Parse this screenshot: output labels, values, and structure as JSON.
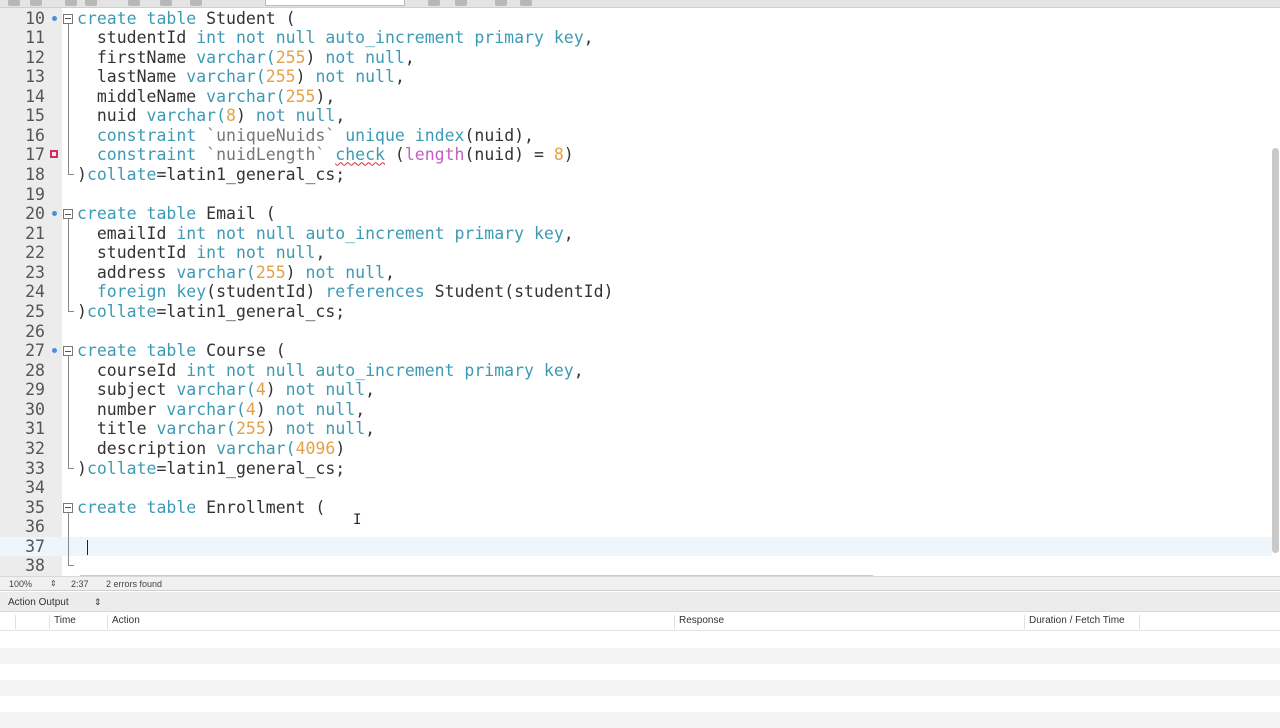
{
  "editor": {
    "first_line": 10,
    "current_line": 37,
    "lines": [
      {
        "n": "10",
        "marker": "dot",
        "fold": "start",
        "segs": [
          [
            "create table",
            "kw"
          ],
          [
            " Student (",
            ""
          ]
        ]
      },
      {
        "n": "11",
        "segs": [
          [
            "  studentId ",
            ""
          ],
          [
            "int not null auto_increment primary key",
            "kw"
          ],
          [
            ",",
            ""
          ]
        ]
      },
      {
        "n": "12",
        "segs": [
          [
            "  firstName ",
            ""
          ],
          [
            "varchar(",
            "kw"
          ],
          [
            "255",
            "num"
          ],
          [
            ") ",
            ""
          ],
          [
            "not null",
            "kw"
          ],
          [
            ",",
            ""
          ]
        ]
      },
      {
        "n": "13",
        "segs": [
          [
            "  lastName ",
            ""
          ],
          [
            "varchar(",
            "kw"
          ],
          [
            "255",
            "num"
          ],
          [
            ") ",
            ""
          ],
          [
            "not null",
            "kw"
          ],
          [
            ",",
            ""
          ]
        ]
      },
      {
        "n": "14",
        "segs": [
          [
            "  middleName ",
            ""
          ],
          [
            "varchar(",
            "kw"
          ],
          [
            "255",
            "num"
          ],
          [
            "),",
            ""
          ]
        ]
      },
      {
        "n": "15",
        "segs": [
          [
            "  nuid ",
            ""
          ],
          [
            "varchar(",
            "kw"
          ],
          [
            "8",
            "num"
          ],
          [
            ") ",
            ""
          ],
          [
            "not null",
            "kw"
          ],
          [
            ",",
            ""
          ]
        ]
      },
      {
        "n": "16",
        "segs": [
          [
            "  ",
            ""
          ],
          [
            "constraint",
            "kw"
          ],
          [
            " `uniqueNuids` ",
            "str"
          ],
          [
            "unique index",
            "kw"
          ],
          [
            "(nuid),",
            ""
          ]
        ]
      },
      {
        "n": "17",
        "marker": "err",
        "segs": [
          [
            "  ",
            ""
          ],
          [
            "constraint",
            "kw"
          ],
          [
            " `nuidLength` ",
            "str"
          ],
          [
            "check",
            "kw squig"
          ],
          [
            " (",
            ""
          ],
          [
            "length",
            "fn"
          ],
          [
            "(nuid) = ",
            ""
          ],
          [
            "8",
            "num"
          ],
          [
            ")",
            ""
          ]
        ]
      },
      {
        "n": "18",
        "fold": "end",
        "segs": [
          [
            ")",
            ""
          ],
          [
            "collate",
            "kw"
          ],
          [
            "=latin1_general_cs;",
            ""
          ]
        ]
      },
      {
        "n": "19",
        "segs": []
      },
      {
        "n": "20",
        "marker": "dot",
        "fold": "start",
        "segs": [
          [
            "create table",
            "kw"
          ],
          [
            " Email (",
            ""
          ]
        ]
      },
      {
        "n": "21",
        "segs": [
          [
            "  emailId ",
            ""
          ],
          [
            "int not null auto_increment primary key",
            "kw"
          ],
          [
            ",",
            ""
          ]
        ]
      },
      {
        "n": "22",
        "segs": [
          [
            "  studentId ",
            ""
          ],
          [
            "int not null",
            "kw"
          ],
          [
            ",",
            ""
          ]
        ]
      },
      {
        "n": "23",
        "segs": [
          [
            "  address ",
            ""
          ],
          [
            "varchar(",
            "kw"
          ],
          [
            "255",
            "num"
          ],
          [
            ") ",
            ""
          ],
          [
            "not null",
            "kw"
          ],
          [
            ",",
            ""
          ]
        ]
      },
      {
        "n": "24",
        "segs": [
          [
            "  ",
            ""
          ],
          [
            "foreign key",
            "kw"
          ],
          [
            "(studentId) ",
            ""
          ],
          [
            "references",
            "kw"
          ],
          [
            " Student(studentId)",
            ""
          ]
        ]
      },
      {
        "n": "25",
        "fold": "end",
        "segs": [
          [
            ")",
            ""
          ],
          [
            "collate",
            "kw"
          ],
          [
            "=latin1_general_cs;",
            ""
          ]
        ]
      },
      {
        "n": "26",
        "segs": []
      },
      {
        "n": "27",
        "marker": "dot",
        "fold": "start",
        "segs": [
          [
            "create table",
            "kw"
          ],
          [
            " Course (",
            ""
          ]
        ]
      },
      {
        "n": "28",
        "segs": [
          [
            "  courseId ",
            ""
          ],
          [
            "int not null auto_increment primary key",
            "kw"
          ],
          [
            ",",
            ""
          ]
        ]
      },
      {
        "n": "29",
        "segs": [
          [
            "  subject ",
            ""
          ],
          [
            "varchar(",
            "kw"
          ],
          [
            "4",
            "num"
          ],
          [
            ") ",
            ""
          ],
          [
            "not null",
            "kw"
          ],
          [
            ",",
            ""
          ]
        ]
      },
      {
        "n": "30",
        "segs": [
          [
            "  number ",
            ""
          ],
          [
            "varchar(",
            "kw"
          ],
          [
            "4",
            "num"
          ],
          [
            ") ",
            ""
          ],
          [
            "not null",
            "kw"
          ],
          [
            ",",
            ""
          ]
        ]
      },
      {
        "n": "31",
        "segs": [
          [
            "  title ",
            ""
          ],
          [
            "varchar(",
            "kw"
          ],
          [
            "255",
            "num"
          ],
          [
            ") ",
            ""
          ],
          [
            "not null",
            "kw"
          ],
          [
            ",",
            ""
          ]
        ]
      },
      {
        "n": "32",
        "segs": [
          [
            "  description ",
            ""
          ],
          [
            "varchar(",
            "kw"
          ],
          [
            "4096",
            "num"
          ],
          [
            ")",
            ""
          ]
        ]
      },
      {
        "n": "33",
        "fold": "end",
        "segs": [
          [
            ")",
            ""
          ],
          [
            "collate",
            "kw"
          ],
          [
            "=latin1_general_cs;",
            ""
          ]
        ]
      },
      {
        "n": "34",
        "segs": []
      },
      {
        "n": "35",
        "fold": "start",
        "segs": [
          [
            "create table",
            "kw"
          ],
          [
            " Enrollment (",
            ""
          ]
        ]
      },
      {
        "n": "36",
        "segs": []
      },
      {
        "n": "37",
        "segs": []
      },
      {
        "n": "38",
        "fold": "end",
        "segs": []
      }
    ]
  },
  "status": {
    "zoom": "100%",
    "position": "2:37",
    "errors": "2 errors found"
  },
  "output": {
    "selector": "Action Output",
    "columns": [
      "Time",
      "Action",
      "Response",
      "Duration / Fetch Time"
    ]
  },
  "colors": {
    "keyword": "#3d9ab4",
    "number": "#e3a24a",
    "function": "#c25fc2",
    "error": "#d0306a",
    "marker": "#4a90d9"
  }
}
